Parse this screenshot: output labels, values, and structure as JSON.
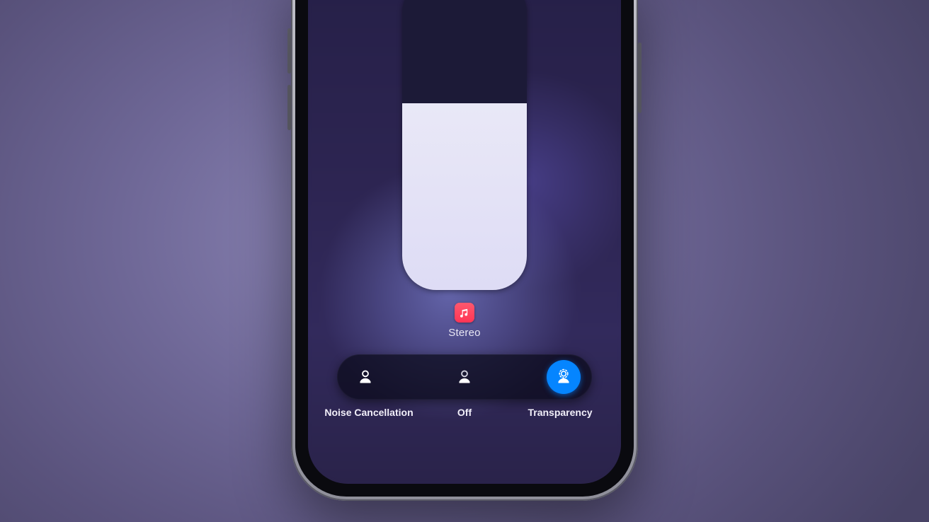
{
  "volume_pct": 60,
  "app": {
    "name": "music-app-icon",
    "label": "Stereo"
  },
  "modes": {
    "nc": {
      "label": "Noise Cancellation",
      "active": false
    },
    "off": {
      "label": "Off",
      "active": false
    },
    "tr": {
      "label": "Transparency",
      "active": true
    }
  },
  "colors": {
    "accent": "#0a84ff",
    "music": "#ff3756"
  }
}
